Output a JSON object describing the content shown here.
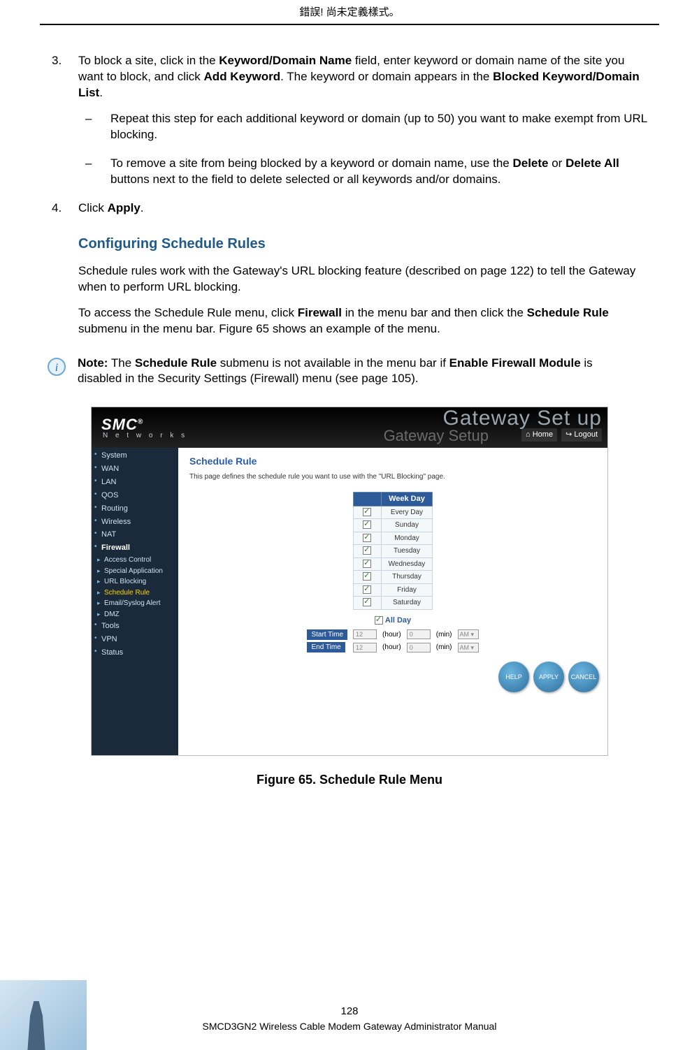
{
  "header_error": "錯誤! 尚未定義樣式。",
  "step3": {
    "num": "3.",
    "text_before": "To block a site, click in the ",
    "bold1": "Keyword/Domain Name",
    "text_mid1": " field, enter keyword or domain name of the site you want to block, and click ",
    "bold2": "Add Keyword",
    "text_mid2": ". The keyword or domain appears in the ",
    "bold3": "Blocked Keyword/Domain List",
    "text_after": ".",
    "bullets": [
      "Repeat this step for each additional keyword or domain (up to 50) you want to make exempt from URL blocking.",
      {
        "pre": "To remove a site from being blocked by a keyword or domain name, use the ",
        "b1": "Delete",
        "mid": " or ",
        "b2": "Delete All",
        "post": " buttons next to the field to delete selected or all keywords and/or domains."
      }
    ]
  },
  "step4": {
    "num": "4.",
    "pre": "Click ",
    "b": "Apply",
    "post": "."
  },
  "subhead": "Configuring Schedule Rules",
  "para1": "Schedule rules work with the Gateway's URL blocking feature (described on page 122) to tell the Gateway when to perform URL blocking.",
  "para2_pre": "To access the Schedule Rule menu, click ",
  "para2_b1": "Firewall",
  "para2_mid": " in the menu bar and then click the ",
  "para2_b2": "Schedule Rule",
  "para2_post": " submenu in the menu bar. Figure 65 shows an example of the menu.",
  "note": {
    "label": "Note:",
    "pre": " The ",
    "b1": "Schedule Rule",
    "mid1": " submenu is not available in the menu bar if ",
    "b2": "Enable Firewall Module",
    "post": " is disabled in the Security Settings (Firewall) menu (see page 105)."
  },
  "screenshot": {
    "logo": "SMC",
    "reg": "®",
    "networks": "N e t w o r k s",
    "gateway_big": "Gateway Set up",
    "gateway_small": "Gateway Setup",
    "home": "⌂ Home",
    "logout": "↪ Logout",
    "sidebar": {
      "top": [
        "System",
        "WAN",
        "LAN",
        "QOS",
        "Routing",
        "Wireless",
        "NAT"
      ],
      "firewall": "Firewall",
      "subs": [
        "Access Control",
        "Special Application",
        "URL Blocking",
        "Schedule Rule",
        "Email/Syslog Alert",
        "DMZ"
      ],
      "bottom": [
        "Tools",
        "VPN",
        "Status"
      ]
    },
    "panel": {
      "title": "Schedule Rule",
      "desc": "This page defines the schedule rule you want to use with the \"URL Blocking\" page.",
      "weekday_header": "Week Day",
      "days": [
        "Every Day",
        "Sunday",
        "Monday",
        "Tuesday",
        "Wednesday",
        "Thursday",
        "Friday",
        "Saturday"
      ],
      "allday": "All Day",
      "start": "Start Time",
      "end": "End Time",
      "hour": "12",
      "hour_label": "(hour)",
      "min": "0",
      "min_label": "(min)",
      "ampm": "AM ▾",
      "buttons": [
        "HELP",
        "APPLY",
        "CANCEL"
      ]
    }
  },
  "figure_caption": "Figure 65. Schedule Rule Menu",
  "page_num": "128",
  "footer_title": "SMCD3GN2 Wireless Cable Modem Gateway Administrator Manual"
}
